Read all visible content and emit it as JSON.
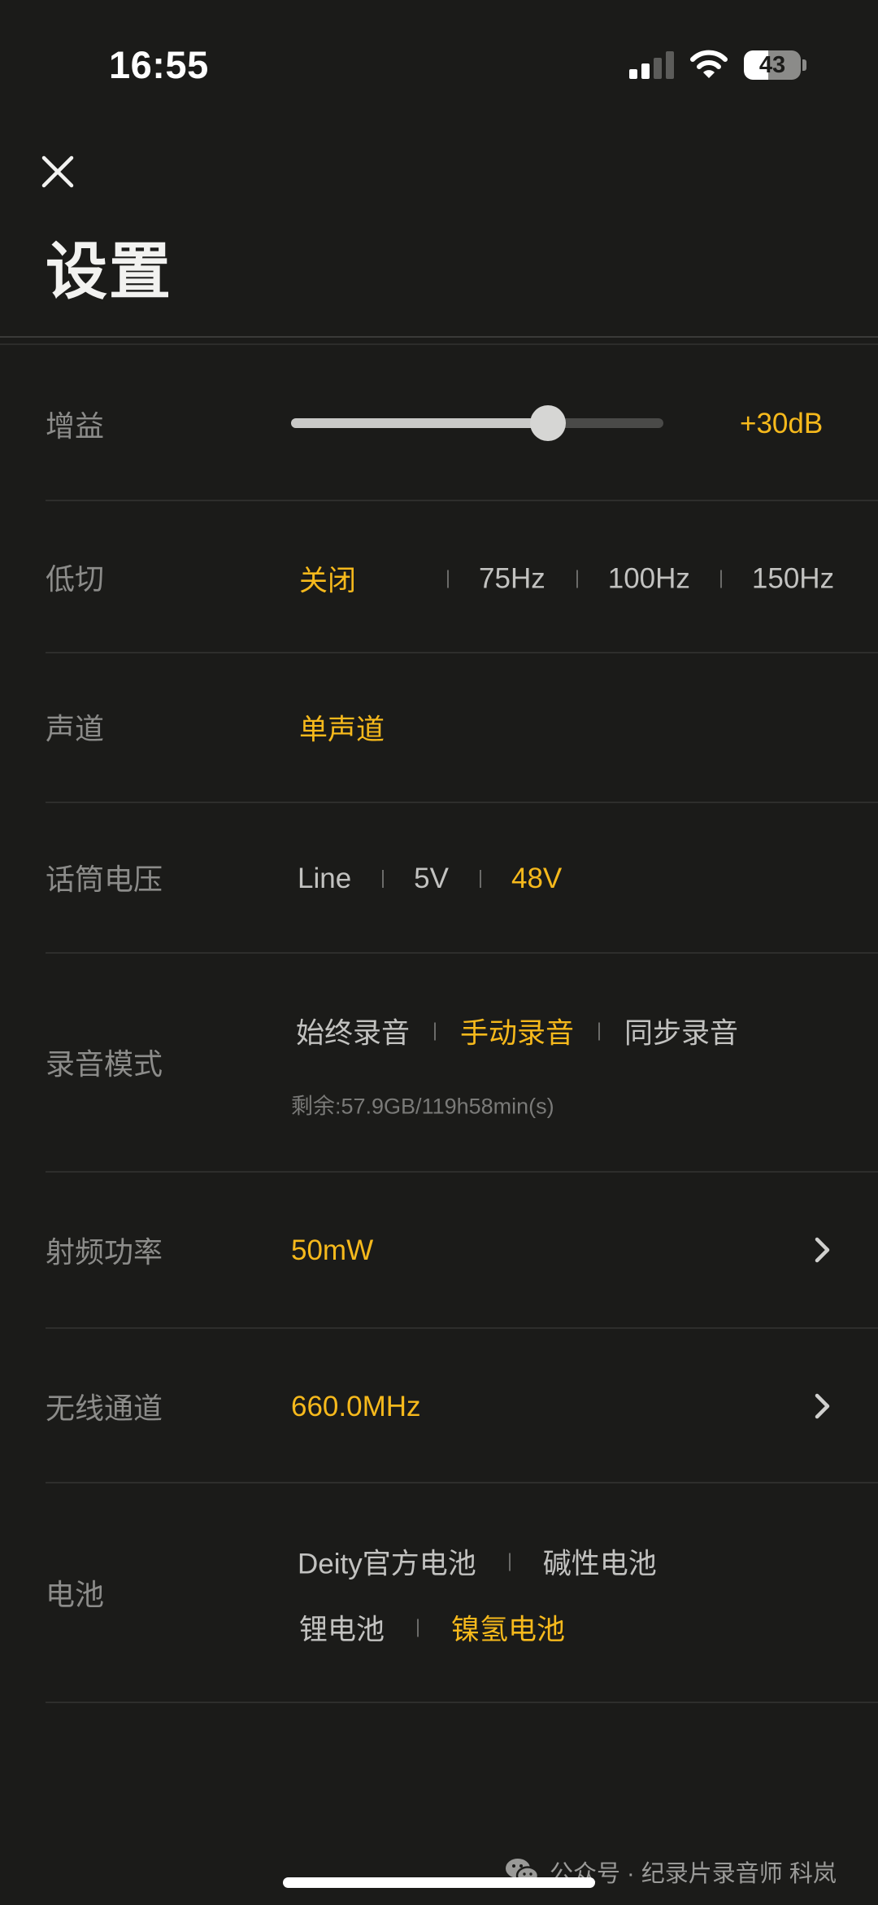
{
  "status_bar": {
    "time": "16:55",
    "battery": "43",
    "battery_level": 0.43,
    "signal_bars_active": 2,
    "icons": [
      "cellular-signal-icon",
      "wifi-icon",
      "battery-icon"
    ]
  },
  "header": {
    "close_icon": "close-icon",
    "title": "设置"
  },
  "settings": {
    "gain": {
      "label": "增益",
      "value": "+30dB",
      "level": 0.69
    },
    "low_cut": {
      "label": "低切",
      "options": [
        "关闭",
        "75Hz",
        "100Hz",
        "150Hz"
      ],
      "selected": "关闭"
    },
    "channel": {
      "label": "声道",
      "value": "单声道"
    },
    "mic_voltage": {
      "label": "话筒电压",
      "options": [
        "Line",
        "5V",
        "48V"
      ],
      "selected": "48V"
    },
    "record_mode": {
      "label": "录音模式",
      "options": [
        "始终录音",
        "手动录音",
        "同步录音"
      ],
      "selected": "手动录音",
      "remaining": "剩余:57.9GB/119h58min(s)"
    },
    "rf_power": {
      "label": "射频功率",
      "value": "50mW",
      "chevron_icon": "chevron-right-icon"
    },
    "wireless_channel": {
      "label": "无线通道",
      "value": "660.0MHz",
      "chevron_icon": "chevron-right-icon"
    },
    "battery_type": {
      "label": "电池",
      "options": [
        "Deity官方电池",
        "碱性电池",
        "锂电池",
        "镍氢电池"
      ],
      "selected": "镍氢电池"
    }
  },
  "footer": {
    "watermark": "公众号 · 纪录片录音师 科岚",
    "watermark_icon": "wechat-icon"
  },
  "colors": {
    "background": "#1b1b19",
    "accent": "#f6b91c",
    "label": "#8c8c8a",
    "option": "#c2c2c0"
  }
}
